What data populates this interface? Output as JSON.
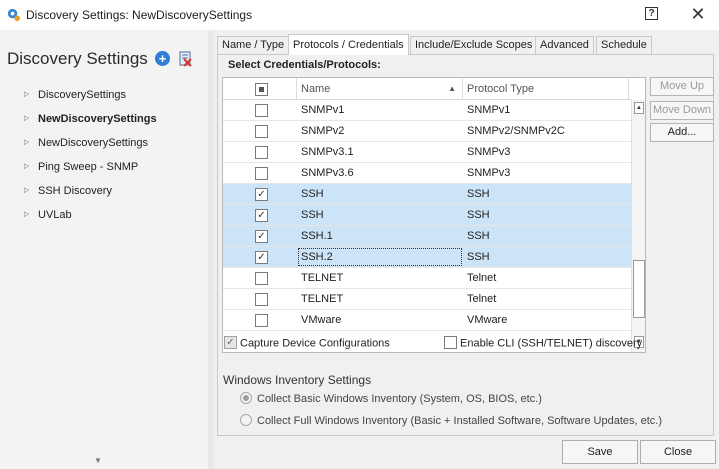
{
  "window": {
    "title": "Discovery Settings: NewDiscoverySettings",
    "help_label": "?",
    "close_label": "✕"
  },
  "sidebar": {
    "header": "Discovery Settings",
    "add_icon": "add-icon",
    "delete_icon": "delete-icon",
    "items": [
      {
        "label": "DiscoverySettings",
        "bold": false
      },
      {
        "label": "NewDiscoverySettings",
        "bold": true
      },
      {
        "label": "NewDiscoverySettings",
        "bold": false
      },
      {
        "label": "Ping Sweep - SNMP",
        "bold": false
      },
      {
        "label": "SSH Discovery",
        "bold": false
      },
      {
        "label": "UVLab",
        "bold": false
      }
    ]
  },
  "tabs": [
    {
      "label": "Name / Type",
      "active": false
    },
    {
      "label": "Protocols / Credentials",
      "active": true
    },
    {
      "label": "Include/Exclude Scopes",
      "active": false
    },
    {
      "label": "Advanced",
      "active": false
    },
    {
      "label": "Schedule",
      "active": false
    }
  ],
  "credentials": {
    "section_title": "Select Credentials/Protocols:",
    "columns": {
      "name": "Name",
      "protocol": "Protocol Type"
    },
    "rows": [
      {
        "name": "SNMPv1",
        "protocol": "SNMPv1",
        "checked": false,
        "selected": false
      },
      {
        "name": "SNMPv2",
        "protocol": "SNMPv2/SNMPv2C",
        "checked": false,
        "selected": false
      },
      {
        "name": "SNMPv3.1",
        "protocol": "SNMPv3",
        "checked": false,
        "selected": false
      },
      {
        "name": "SNMPv3.6",
        "protocol": "SNMPv3",
        "checked": false,
        "selected": false
      },
      {
        "name": "SSH",
        "protocol": "SSH",
        "checked": true,
        "selected": true
      },
      {
        "name": "SSH",
        "protocol": "SSH",
        "checked": true,
        "selected": true
      },
      {
        "name": "SSH.1",
        "protocol": "SSH",
        "checked": true,
        "selected": true
      },
      {
        "name": "SSH.2",
        "protocol": "SSH",
        "checked": true,
        "selected": true
      },
      {
        "name": "TELNET",
        "protocol": "Telnet",
        "checked": false,
        "selected": false
      },
      {
        "name": "TELNET",
        "protocol": "Telnet",
        "checked": false,
        "selected": false
      },
      {
        "name": "VMware",
        "protocol": "VMware",
        "checked": false,
        "selected": false
      }
    ],
    "buttons": {
      "move_up": "Move Up",
      "move_down": "Move Down",
      "add": "Add..."
    }
  },
  "options": {
    "capture_config": {
      "label": "Capture Device Configurations",
      "checked": true
    },
    "enable_cli": {
      "label": "Enable CLI (SSH/TELNET) discovery",
      "checked": false
    }
  },
  "windows_inventory": {
    "title": "Windows Inventory Settings",
    "basic": {
      "label": "Collect Basic Windows Inventory (System, OS, BIOS, etc.)",
      "selected": true
    },
    "full": {
      "label": "Collect Full Windows Inventory (Basic + Installed Software, Software Updates, etc.)",
      "selected": false
    }
  },
  "footer": {
    "save": "Save",
    "close": "Close"
  },
  "colors": {
    "selection": "#cce4f7",
    "accent": "#2f7fd6",
    "delete": "#d9342b"
  }
}
